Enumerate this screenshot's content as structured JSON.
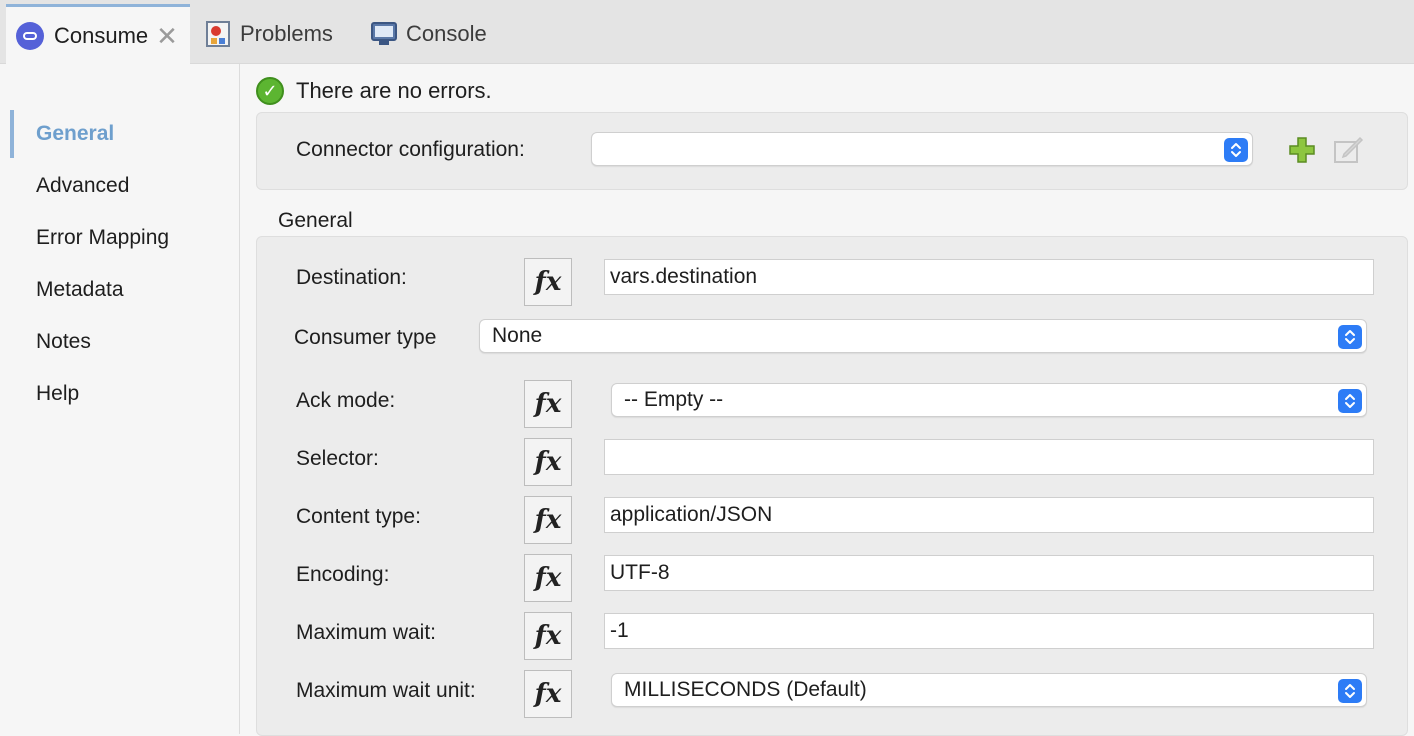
{
  "tabs": [
    {
      "label": "Consume",
      "icon": "consume-icon",
      "active": true
    },
    {
      "label": "Problems",
      "icon": "problems-icon"
    },
    {
      "label": "Console",
      "icon": "console-icon"
    }
  ],
  "nav": {
    "items": [
      "General",
      "Advanced",
      "Error Mapping",
      "Metadata",
      "Notes",
      "Help"
    ],
    "active": "General"
  },
  "status": {
    "message": "There are no errors.",
    "icon": "check-circle-icon"
  },
  "connector": {
    "label": "Connector configuration:",
    "value": ""
  },
  "section_title": "General",
  "fields": {
    "destination": {
      "label": "Destination:",
      "value": "vars.destination"
    },
    "consumer_type": {
      "label": "Consumer type",
      "value": "None"
    },
    "ack_mode": {
      "label": "Ack mode:",
      "value": "-- Empty --"
    },
    "selector": {
      "label": "Selector:",
      "value": ""
    },
    "content_type": {
      "label": "Content type:",
      "value": "application/JSON"
    },
    "encoding": {
      "label": "Encoding:",
      "value": "UTF-8"
    },
    "maximum_wait": {
      "label": "Maximum wait:",
      "value": "-1"
    },
    "maximum_wait_unit": {
      "label": "Maximum wait unit:",
      "value": "MILLISECONDS (Default)"
    }
  },
  "fx_label": "fx",
  "colors": {
    "accent": "#8fb3d9",
    "nav_active": "#6e9fcd",
    "stepper": "#2d7cf6",
    "ok_green": "#5cb531"
  }
}
